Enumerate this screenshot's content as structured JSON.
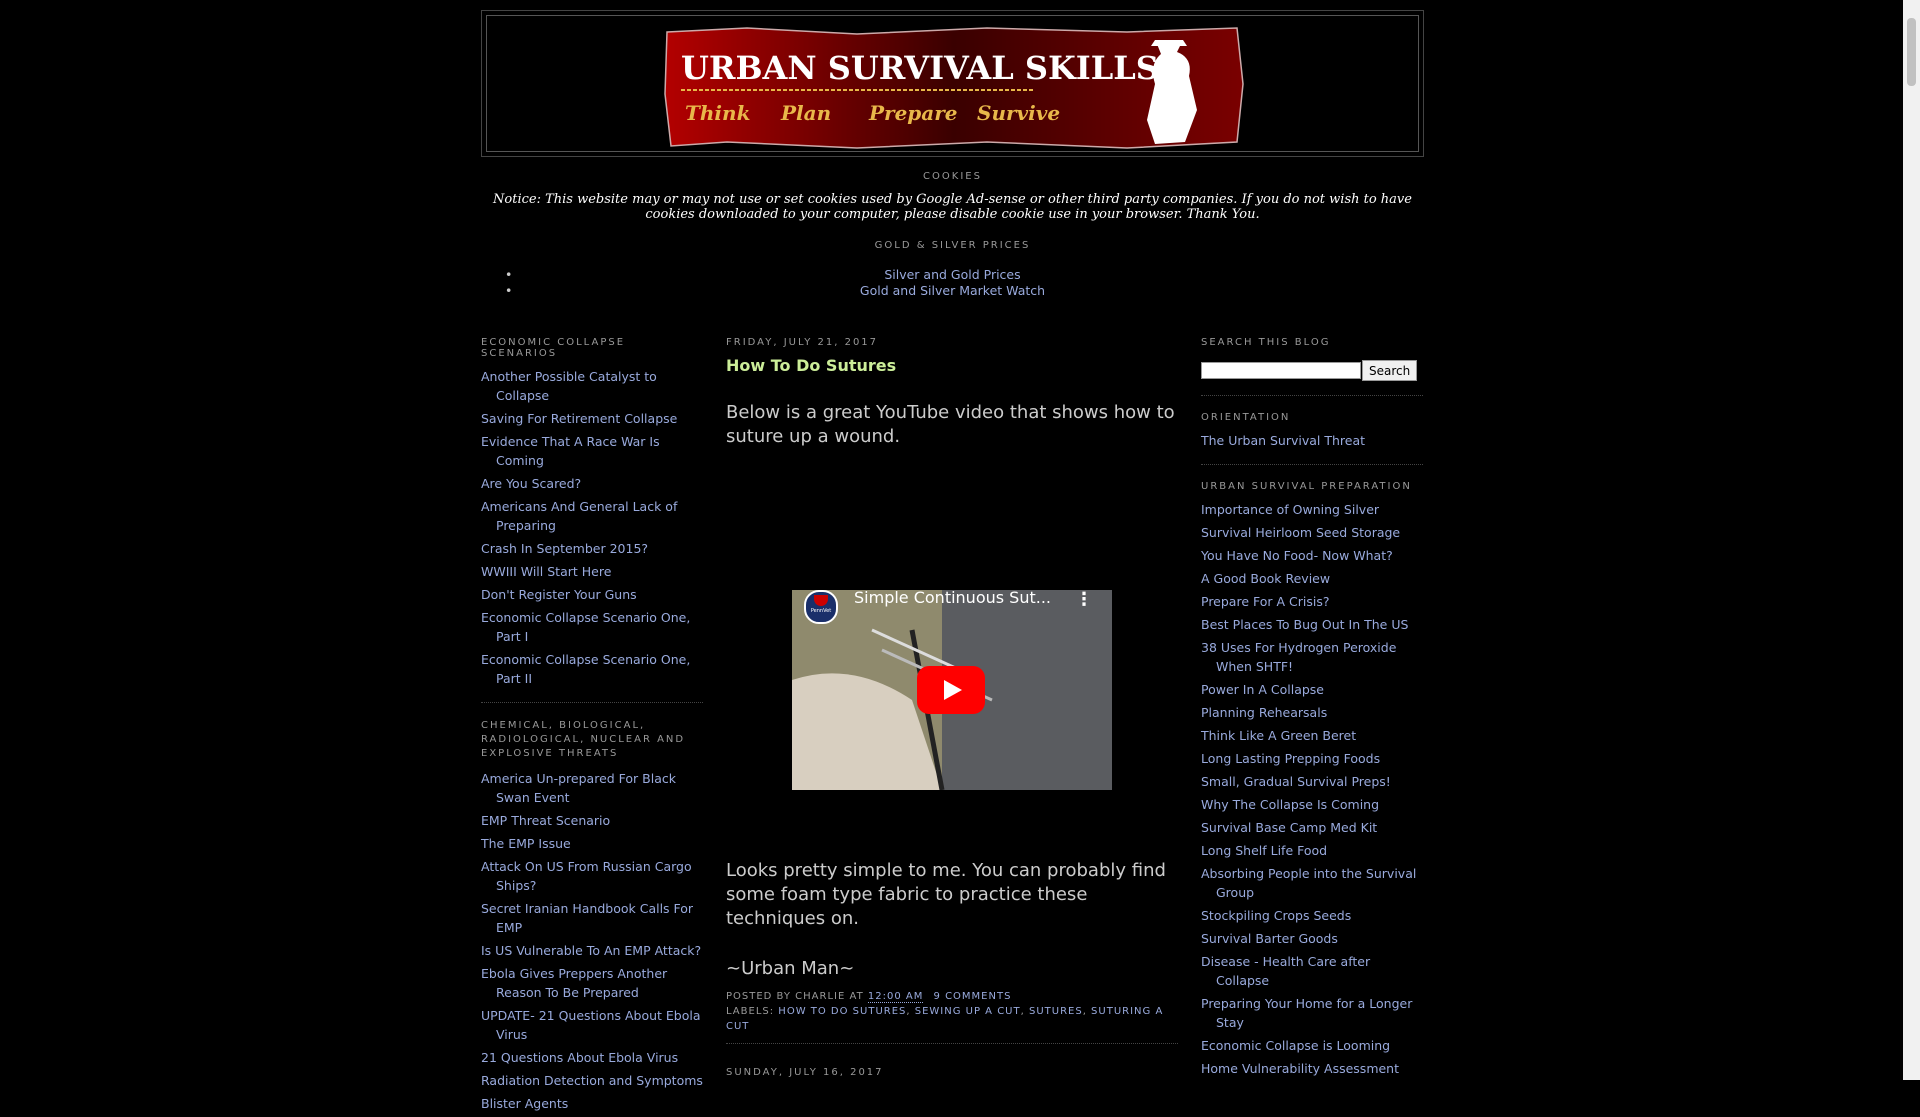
{
  "header": {
    "title": "URBAN SURVIVAL SKILLS",
    "taglines": [
      "Think",
      "Plan",
      "Prepare",
      "Survive"
    ]
  },
  "cookies": {
    "heading": "COOKIES",
    "notice": "Notice: This website may or may not use or set cookies used by Google Ad-sense or other third party companies. If you do not wish to have cookies downloaded to your computer, please disable cookie use in your browser. Thank You."
  },
  "gold": {
    "heading": "GOLD & SILVER PRICES",
    "links": [
      "Silver and Gold Prices",
      "Gold and Silver Market Watch"
    ]
  },
  "left_sidebar": {
    "sections": [
      {
        "heading": "ECONOMIC COLLAPSE SCENARIOS",
        "links": [
          "Another Possible Catalyst to Collapse",
          "Saving For Retirement Collapse",
          "Evidence That A Race War Is Coming",
          "Are You Scared?",
          "Americans And General Lack of Preparing",
          "Crash In September 2015?",
          "WWIII Will Start Here",
          "Don't Register Your Guns",
          "Economic Collapse Scenario One, Part I",
          "Economic Collapse Scenario One, Part II"
        ]
      },
      {
        "heading": "CHEMICAL, BIOLOGICAL, RADIOLOGICAL, NUCLEAR AND EXPLOSIVE THREATS",
        "links": [
          "America Un-prepared For Black Swan Event",
          "EMP Threat Scenario",
          "The EMP Issue",
          "Attack On US From Russian Cargo Ships?",
          "Secret Iranian Handbook Calls For EMP",
          "Is US Vulnerable To An EMP Attack?",
          "Ebola Gives Preppers Another Reason To Be Prepared",
          "UPDATE- 21 Questions About Ebola Virus",
          "21 Questions About Ebola Virus",
          "Radiation Detection and Symptoms",
          "Blister Agents"
        ]
      }
    ]
  },
  "post": {
    "date": "FRIDAY, JULY 21, 2017",
    "title": "How To Do Sutures",
    "intro": "Below is a great YouTube video that shows how to suture up a wound.",
    "video_title": "Simple Continuous Sut...",
    "video_channel_badge": "PennVet",
    "after": "Looks pretty simple to me. You can probably find some foam type fabric to practice these techniques on.",
    "signature": "~Urban Man~",
    "posted_by_prefix": "POSTED BY",
    "author": "CHARLIE",
    "at_word": "AT",
    "time": "12:00 AM",
    "comments": "9 COMMENTS",
    "labels_prefix": "LABELS:",
    "labels": [
      "HOW TO DO SUTURES",
      "SEWING UP A CUT",
      "SUTURES",
      "SUTURING A CUT"
    ],
    "next_date": "SUNDAY, JULY 16, 2017"
  },
  "right_sidebar": {
    "search_heading": "SEARCH THIS BLOG",
    "search_button": "Search",
    "search_value": "",
    "orientation_heading": "ORIENTATION",
    "orientation_links": [
      "The Urban Survival Threat"
    ],
    "prep_heading": "URBAN SURVIVAL PREPARATION",
    "prep_links": [
      "Importance of Owning Silver",
      "Survival Heirloom Seed Storage",
      "You Have No Food- Now What?",
      "A Good Book Review",
      "Prepare For A Crisis?",
      "Best Places To Bug Out In The US",
      "38 Uses For Hydrogen Peroxide When SHTF!",
      "Power In A Collapse",
      "Planning Rehearsals",
      "Think Like A Green Beret",
      "Long Lasting Prepping Foods",
      "Small, Gradual Survival Preps!",
      "Why The Collapse Is Coming",
      "Survival Base Camp Med Kit",
      "Long Shelf Life Food",
      "Absorbing People into the Survival Group",
      "Stockpiling Crops Seeds",
      "Survival Barter Goods",
      "Disease - Health Care after Collapse",
      "Preparing Your Home for a Longer Stay",
      "Economic Collapse is Looming",
      "Home Vulnerability Assessment"
    ]
  },
  "colors": {
    "background": "#000000",
    "link": "#99aadd",
    "post_title": "#ccee99",
    "banner_red": "#8b0000",
    "tagline_gold": "#e8b84a"
  }
}
